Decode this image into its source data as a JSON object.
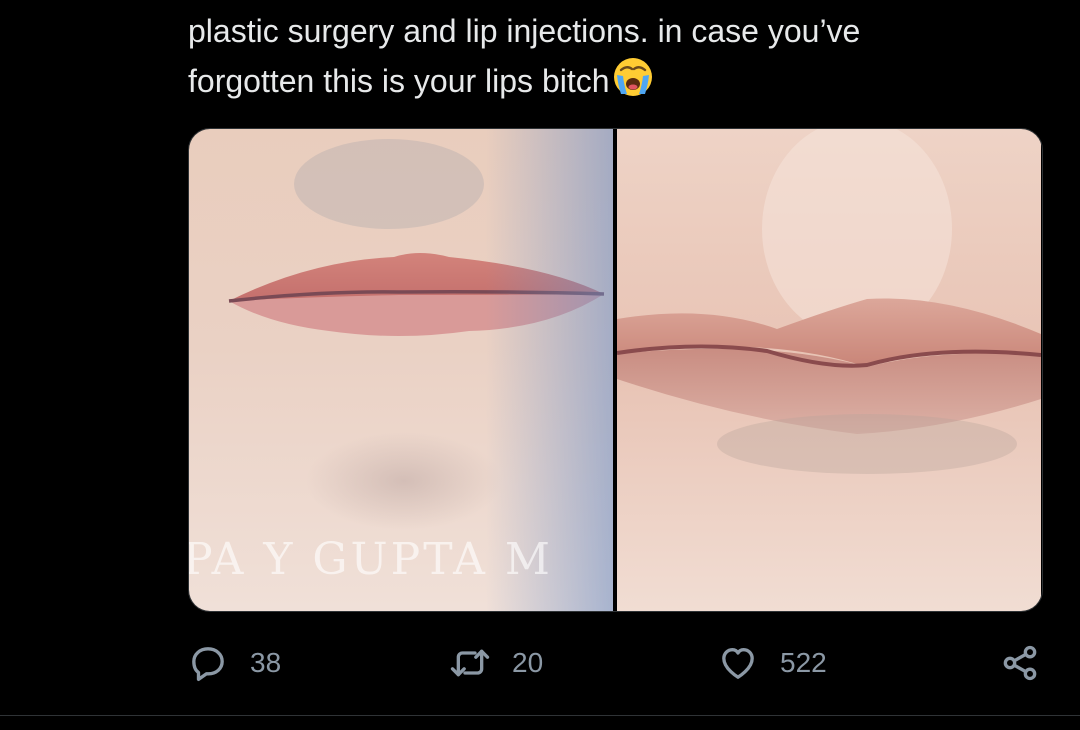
{
  "tweet": {
    "text_line1": "plastic surgery and lip injections. in case you’ve",
    "text_line2": "forgotten this is your lips bitch",
    "emoji": "loudly-crying-face-emoji"
  },
  "media": {
    "watermark": "PA Y GUPTA M"
  },
  "actions": {
    "reply": {
      "icon": "reply-icon",
      "count": "38"
    },
    "retweet": {
      "icon": "retweet-icon",
      "count": "20"
    },
    "like": {
      "icon": "heart-icon",
      "count": "522"
    },
    "share": {
      "icon": "share-icon"
    }
  },
  "colors": {
    "background": "#000000",
    "text": "#e7e9ea",
    "muted": "#8b98a5",
    "border": "#2f3336"
  }
}
